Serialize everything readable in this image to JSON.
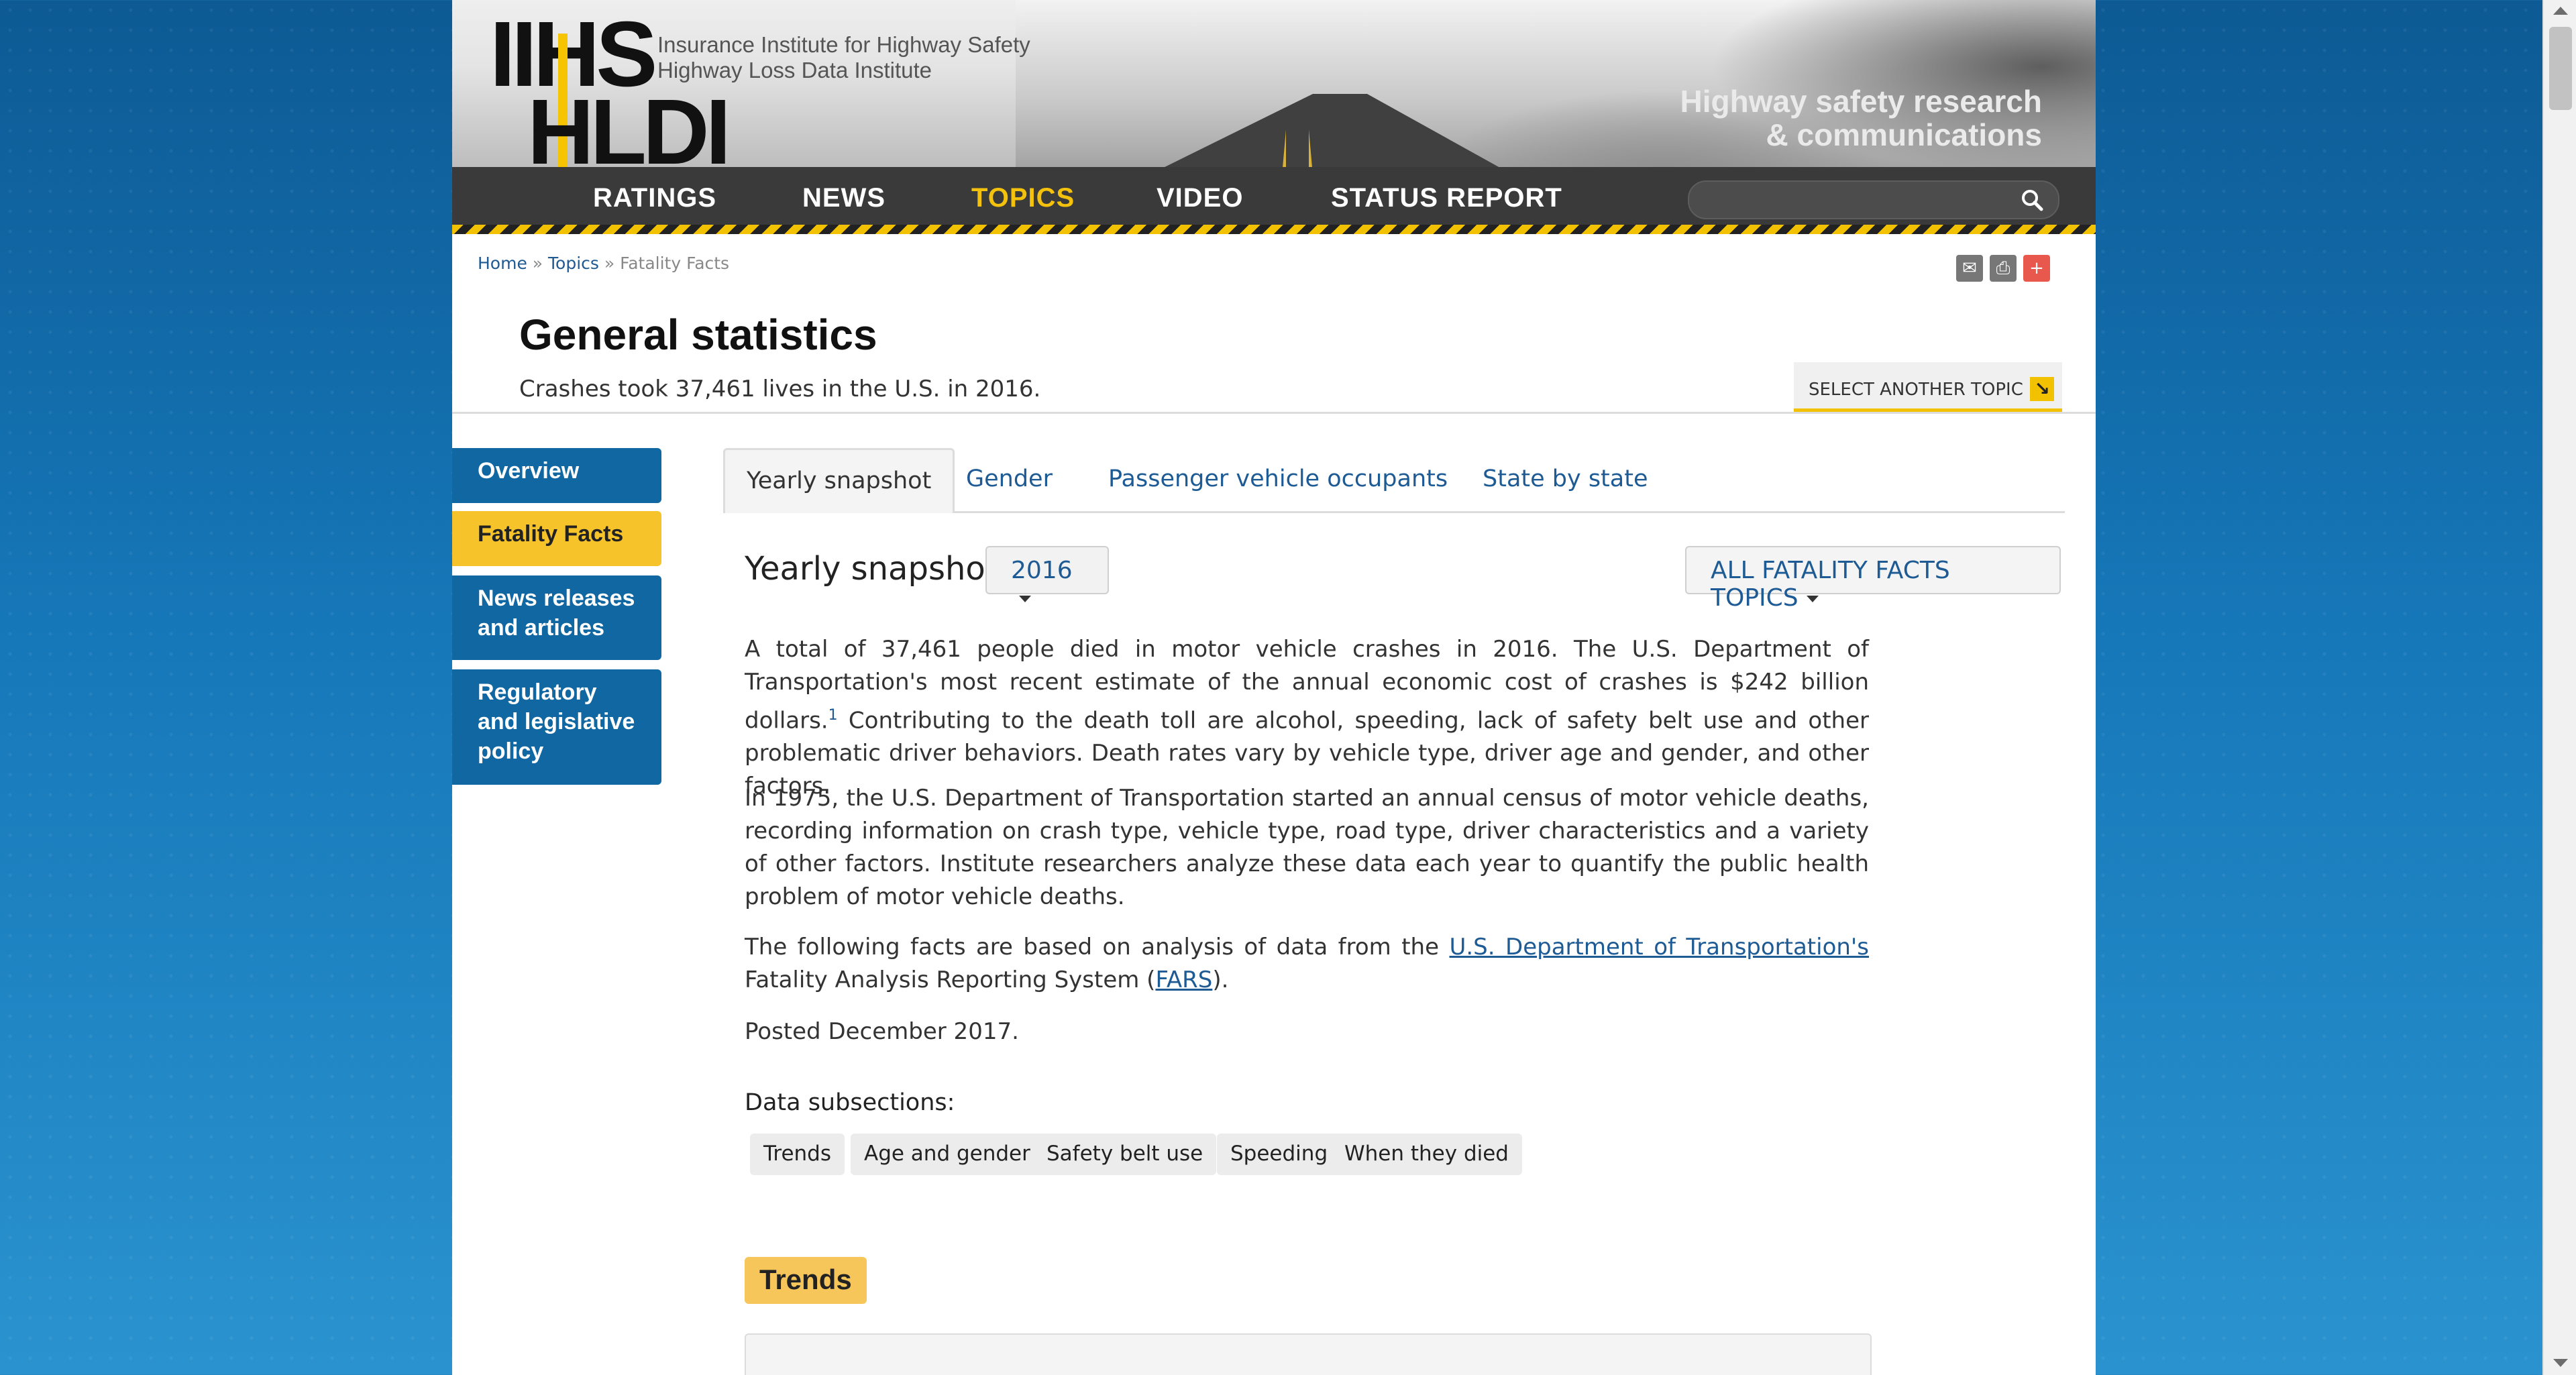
{
  "logo": {
    "line1": "Insurance Institute for Highway Safety",
    "line2": "Highway Loss Data Institute"
  },
  "tagline": {
    "line1": "Highway safety research",
    "line2": "& communications"
  },
  "nav": [
    "RATINGS",
    "NEWS",
    "TOPICS",
    "VIDEO",
    "STATUS REPORT"
  ],
  "nav_active": "TOPICS",
  "breadcrumb": {
    "home": "Home",
    "sep1": "»",
    "topics": "Topics",
    "sep2": "»",
    "current": "Fatality Facts"
  },
  "page": {
    "title": "General statistics",
    "subtitle": "Crashes took 37,461 lives in the U.S. in 2016.",
    "select_topic": "SELECT ANOTHER TOPIC"
  },
  "sidebar": [
    {
      "label": "Overview"
    },
    {
      "label": "Fatality Facts"
    },
    {
      "label": "News releases and articles"
    },
    {
      "label": "Regulatory and legislative policy"
    }
  ],
  "tabs": [
    "Yearly snapshot",
    "Gender",
    "Passenger vehicle occupants",
    "State by state"
  ],
  "snapshot": {
    "title": "Yearly snapshot",
    "year": "2016",
    "topics_button": "ALL FATALITY FACTS TOPICS"
  },
  "content": {
    "p1a": "A total of 37,461 people died in motor vehicle crashes in 2016. The U.S. Department of Transportation's most recent estimate of the annual economic cost of crashes is $242 billion dollars.",
    "p1_sup": "1",
    "p1b": " Contributing to the death toll are alcohol, speeding, lack of safety belt use and other problematic driver behaviors. Death rates vary by vehicle type, driver age and gender, and other factors.",
    "p2": "In 1975, the U.S. Department of Transportation started an annual census of motor vehicle deaths, recording information on crash type, vehicle type, road type, driver characteristics and a variety of other factors. Institute researchers analyze these data each year to quantify the public health problem of motor vehicle deaths.",
    "p3a": "The following facts are based on analysis of data from the ",
    "p3_link1": "U.S. Department of Transportation's",
    "p3b": " Fatality Analysis Reporting System (",
    "p3_link2": "FARS",
    "p3c": ").",
    "posted": "Posted December 2017."
  },
  "subsections": {
    "label": "Data subsections:",
    "items": [
      "Trends",
      "Age and gender",
      "Safety belt use",
      "Speeding",
      "When they died"
    ]
  },
  "trends_heading": "Trends",
  "colors": {
    "accent_yellow": "#f6c32b",
    "sidebar_blue": "#1167a2",
    "link_blue": "#1e5b95"
  }
}
